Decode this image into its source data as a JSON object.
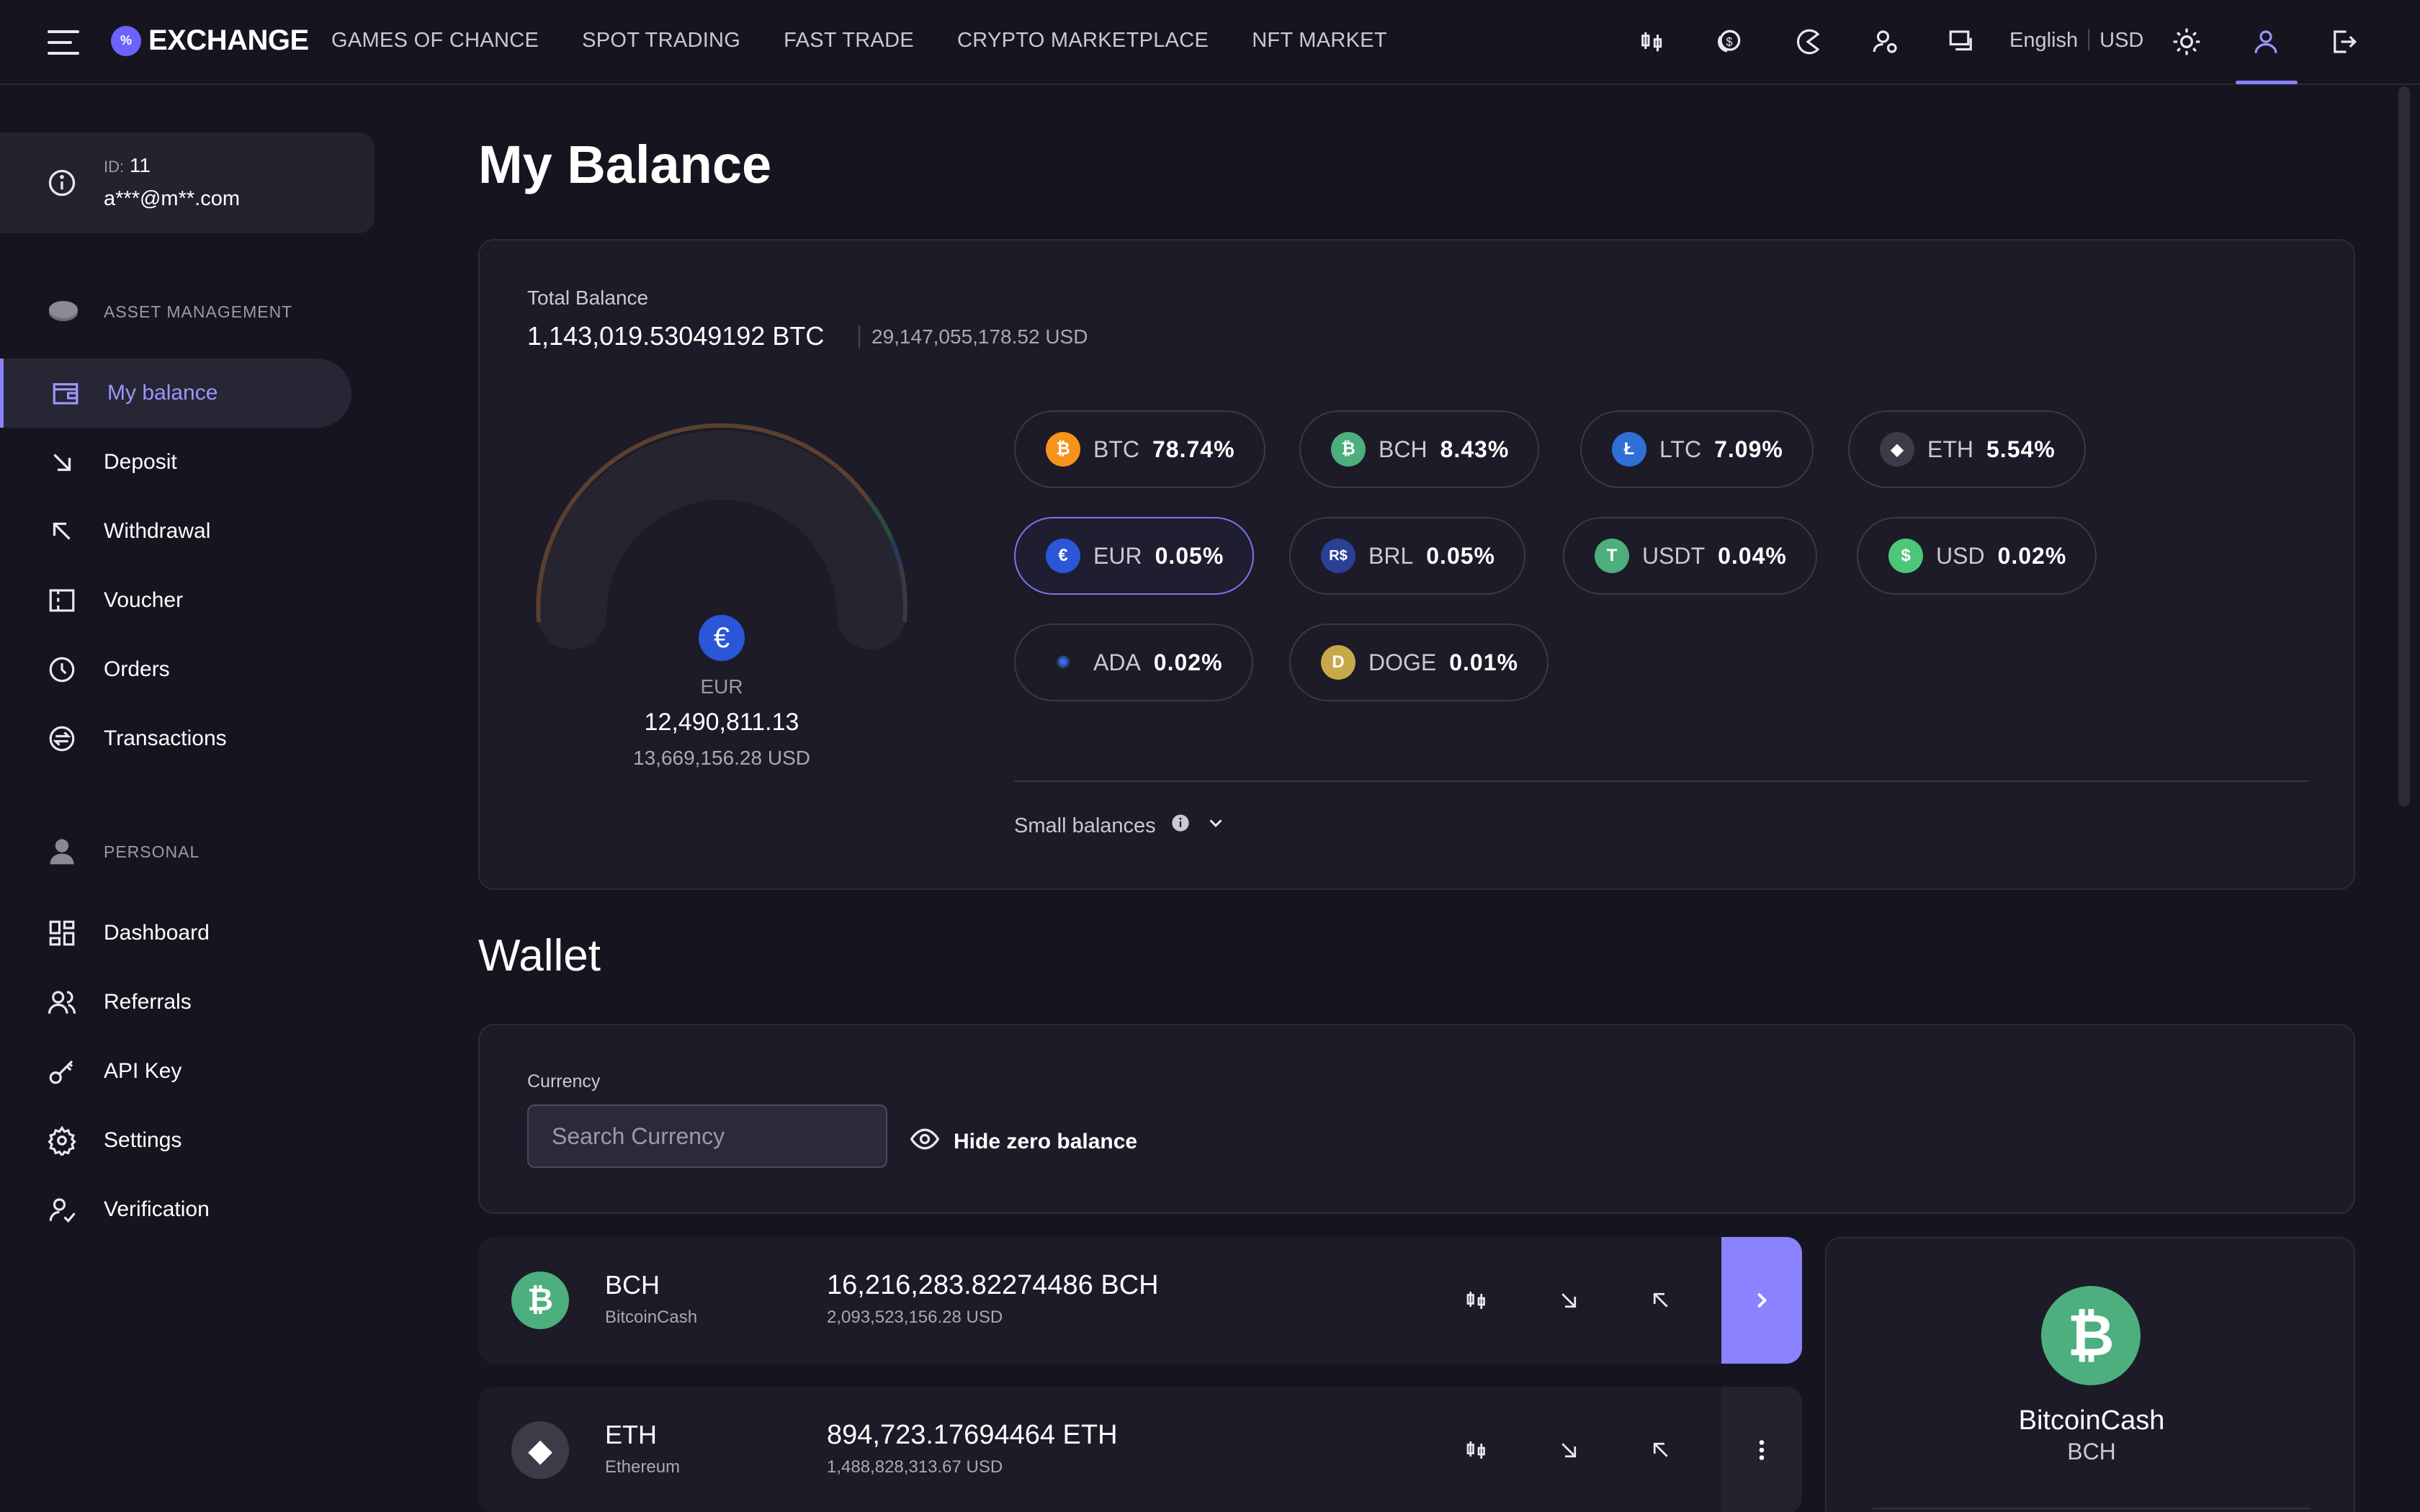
{
  "brand": {
    "logo_text": "%",
    "name": "EXCHANGE"
  },
  "nav": {
    "links": [
      "GAMES OF CHANCE",
      "SPOT TRADING",
      "FAST TRADE",
      "CRYPTO MARKETPLACE",
      "NFT MARKET"
    ],
    "icons": [
      "trading-icon",
      "coins-icon",
      "pacman-icon",
      "user-settings-icon",
      "chat-icon",
      "sun-icon",
      "profile-icon",
      "logout-icon"
    ],
    "language": "English",
    "currency": "USD"
  },
  "user": {
    "id_label": "ID:",
    "id_value": "11",
    "email": "a***@m**.com"
  },
  "sidebar": {
    "section_asset": "ASSET MANAGEMENT",
    "section_personal": "PERSONAL",
    "asset_items": [
      {
        "label": "My balance",
        "icon": "wallet-icon"
      },
      {
        "label": "Deposit",
        "icon": "arrow-down-right-icon"
      },
      {
        "label": "Withdrawal",
        "icon": "arrow-up-left-icon"
      },
      {
        "label": "Voucher",
        "icon": "voucher-icon"
      },
      {
        "label": "Orders",
        "icon": "orders-icon"
      },
      {
        "label": "Transactions",
        "icon": "transactions-icon"
      }
    ],
    "personal_items": [
      {
        "label": "Dashboard",
        "icon": "dashboard-icon"
      },
      {
        "label": "Referrals",
        "icon": "referrals-icon"
      },
      {
        "label": "API Key",
        "icon": "key-icon"
      },
      {
        "label": "Settings",
        "icon": "gear-icon"
      },
      {
        "label": "Verification",
        "icon": "verification-icon"
      }
    ]
  },
  "balance": {
    "title": "My Balance",
    "total_label": "Total Balance",
    "total_btc": "1,143,019.53049192 BTC",
    "total_usd": "29,147,055,178.52 USD",
    "gauge": {
      "symbol": "EUR",
      "amount": "12,490,811.13",
      "usd": "13,669,156.28 USD"
    },
    "pills": [
      {
        "sym": "BTC",
        "pct": "78.74%",
        "color": "#f7931a",
        "glyph": "₿"
      },
      {
        "sym": "BCH",
        "pct": "8.43%",
        "color": "#4caf7d",
        "glyph": "₿"
      },
      {
        "sym": "LTC",
        "pct": "7.09%",
        "color": "#2f6fd6",
        "glyph": "Ł"
      },
      {
        "sym": "ETH",
        "pct": "5.54%",
        "color": "#3c3c48",
        "glyph": "◆"
      },
      {
        "sym": "EUR",
        "pct": "0.05%",
        "color": "#2a56d8",
        "glyph": "€"
      },
      {
        "sym": "BRL",
        "pct": "0.05%",
        "color": "#2a3f96",
        "glyph": "R$"
      },
      {
        "sym": "USDT",
        "pct": "0.04%",
        "color": "#4caf7d",
        "glyph": "T"
      },
      {
        "sym": "USD",
        "pct": "0.02%",
        "color": "#4cc77a",
        "glyph": "$"
      },
      {
        "sym": "ADA",
        "pct": "0.02%",
        "color": "#1c1b27",
        "glyph": "✺"
      },
      {
        "sym": "DOGE",
        "pct": "0.01%",
        "color": "#c8a94a",
        "glyph": "D"
      }
    ],
    "small_balances": "Small balances"
  },
  "wallet": {
    "title": "Wallet",
    "currency_label": "Currency",
    "search_placeholder": "Search Currency",
    "hide_zero": "Hide zero balance",
    "rows": [
      {
        "sym": "BCH",
        "name": "BitcoinCash",
        "amount": "16,216,283.82274486 BCH",
        "usd": "2,093,523,156.28 USD",
        "color": "#4caf7d",
        "glyph": "₿"
      },
      {
        "sym": "ETH",
        "name": "Ethereum",
        "amount": "894,723.17694464 ETH",
        "usd": "1,488,828,313.67 USD",
        "color": "#3c3c48",
        "glyph": "◆"
      }
    ],
    "detail": {
      "name": "BitcoinCash",
      "sym": "BCH",
      "glyph": "₿"
    }
  }
}
